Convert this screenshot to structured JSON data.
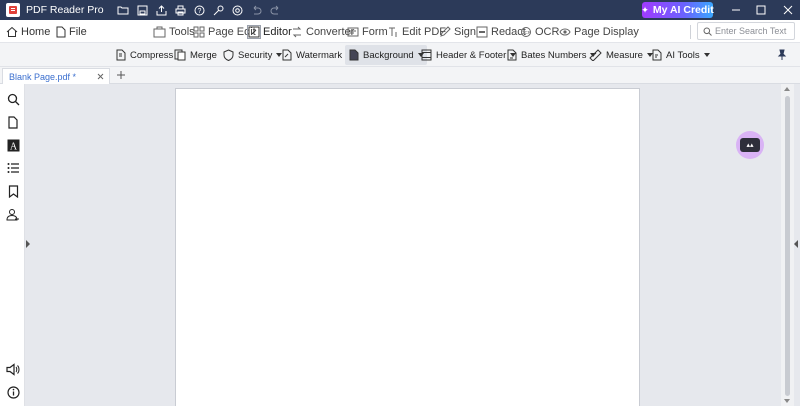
{
  "app": {
    "title": "PDF Reader Pro",
    "ai_credit_label": "My AI Credit"
  },
  "quick_access": [
    "open-folder-icon",
    "save-icon",
    "share-icon",
    "print-icon",
    "help-icon",
    "key-icon",
    "settings-icon",
    "undo-icon",
    "redo-icon"
  ],
  "menu": {
    "home": "Home",
    "file": "File",
    "tools": "Tools",
    "page_edit": "Page Edit",
    "editor": "Editor",
    "converter": "Converter",
    "form": "Form",
    "edit_pdf": "Edit PDF",
    "sign": "Sign",
    "redact": "Redact",
    "ocr": "OCR",
    "page_display": "Page Display",
    "active": "Editor"
  },
  "search": {
    "placeholder": "Enter Search Text"
  },
  "ribbon": {
    "compress": "Compress",
    "merge": "Merge",
    "security": "Security",
    "watermark": "Watermark",
    "background": "Background",
    "header_footer": "Header & Footer",
    "bates_numbers": "Bates Numbers",
    "measure": "Measure",
    "ai_tools": "AI Tools",
    "hovered": "Background"
  },
  "tabs": [
    {
      "label": "Blank Page.pdf *"
    }
  ],
  "sidebar_icons": [
    "search-icon",
    "page-thumbnails-icon",
    "text-icon",
    "outline-icon",
    "bookmark-icon",
    "signature-icon",
    "speaker-icon",
    "info-icon"
  ],
  "colors": {
    "titlebar": "#2c3a59",
    "accent": "#3b6fcf",
    "ai_gradient_start": "#a03bff",
    "ai_gradient_end": "#3aa7ff"
  }
}
